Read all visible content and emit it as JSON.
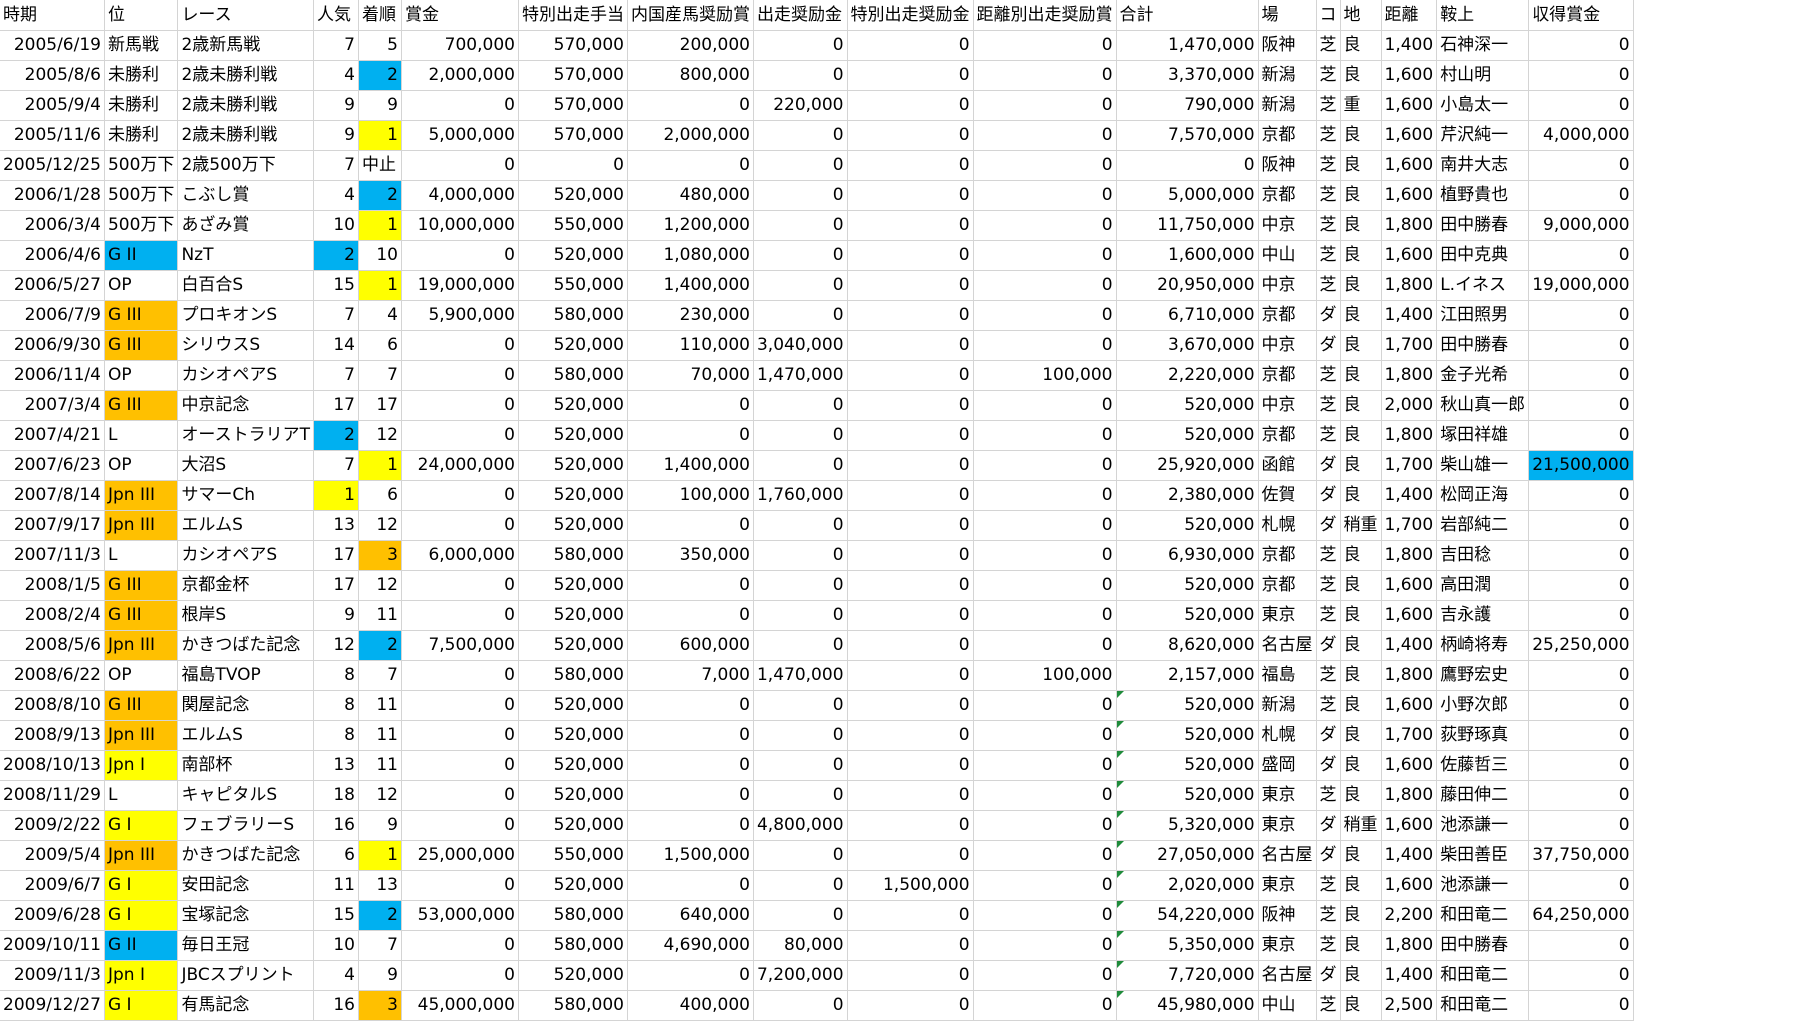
{
  "colors": {
    "yellow": "#ffff00",
    "orange": "#ffc000",
    "blue": "#00b0f0",
    "gridline": "#d4d4d4",
    "error_flag": "#1e8b3a"
  },
  "headers": [
    "時期",
    "位",
    "レース",
    "人気",
    "着順",
    "賞金",
    "特別出走手当",
    "内国産馬奨励賞",
    "出走奨励金",
    "特別出走奨励金",
    "距離別出走奨励賞",
    "合計",
    "場",
    "コ",
    "地",
    "距離",
    "鞍上",
    "収得賞金"
  ],
  "rows": [
    {
      "cells": [
        "2005/6/19",
        "新馬戦",
        "2歳新馬戦",
        "7",
        "5",
        "700,000",
        "570,000",
        "200,000",
        "0",
        "0",
        "0",
        "1,470,000",
        "阪神",
        "芝",
        "良",
        "1,400",
        "石神深一",
        "0"
      ],
      "hl": {}
    },
    {
      "cells": [
        "2005/8/6",
        "未勝利",
        "2歳未勝利戦",
        "4",
        "2",
        "2,000,000",
        "570,000",
        "800,000",
        "0",
        "0",
        "0",
        "3,370,000",
        "新潟",
        "芝",
        "良",
        "1,600",
        "村山明",
        "0"
      ],
      "hl": {
        "4": "blue"
      }
    },
    {
      "cells": [
        "2005/9/4",
        "未勝利",
        "2歳未勝利戦",
        "9",
        "9",
        "0",
        "570,000",
        "0",
        "220,000",
        "0",
        "0",
        "790,000",
        "新潟",
        "芝",
        "重",
        "1,600",
        "小島太一",
        "0"
      ],
      "hl": {}
    },
    {
      "cells": [
        "2005/11/6",
        "未勝利",
        "2歳未勝利戦",
        "9",
        "1",
        "5,000,000",
        "570,000",
        "2,000,000",
        "0",
        "0",
        "0",
        "7,570,000",
        "京都",
        "芝",
        "良",
        "1,600",
        "芹沢純一",
        "4,000,000"
      ],
      "hl": {
        "4": "yellow"
      }
    },
    {
      "cells": [
        "2005/12/25",
        "500万下",
        "2歳500万下",
        "7",
        "中止",
        "0",
        "0",
        "0",
        "0",
        "0",
        "0",
        "0",
        "阪神",
        "芝",
        "良",
        "1,600",
        "南井大志",
        "0"
      ],
      "hl": {}
    },
    {
      "cells": [
        "2006/1/28",
        "500万下",
        "こぶし賞",
        "4",
        "2",
        "4,000,000",
        "520,000",
        "480,000",
        "0",
        "0",
        "0",
        "5,000,000",
        "京都",
        "芝",
        "良",
        "1,600",
        "植野貴也",
        "0"
      ],
      "hl": {
        "4": "blue"
      }
    },
    {
      "cells": [
        "2006/3/4",
        "500万下",
        "あざみ賞",
        "10",
        "1",
        "10,000,000",
        "550,000",
        "1,200,000",
        "0",
        "0",
        "0",
        "11,750,000",
        "中京",
        "芝",
        "良",
        "1,800",
        "田中勝春",
        "9,000,000"
      ],
      "hl": {
        "4": "yellow"
      }
    },
    {
      "cells": [
        "2006/4/6",
        "G II",
        "NzT",
        "2",
        "10",
        "0",
        "520,000",
        "1,080,000",
        "0",
        "0",
        "0",
        "1,600,000",
        "中山",
        "芝",
        "良",
        "1,600",
        "田中克典",
        "0"
      ],
      "hl": {
        "1": "blue",
        "3": "blue"
      }
    },
    {
      "cells": [
        "2006/5/27",
        "OP",
        "白百合S",
        "15",
        "1",
        "19,000,000",
        "550,000",
        "1,400,000",
        "0",
        "0",
        "0",
        "20,950,000",
        "中京",
        "芝",
        "良",
        "1,800",
        "L.イネス",
        "19,000,000"
      ],
      "hl": {
        "4": "yellow"
      }
    },
    {
      "cells": [
        "2006/7/9",
        "G III",
        "プロキオンS",
        "7",
        "4",
        "5,900,000",
        "580,000",
        "230,000",
        "0",
        "0",
        "0",
        "6,710,000",
        "京都",
        "ダ",
        "良",
        "1,400",
        "江田照男",
        "0"
      ],
      "hl": {
        "1": "orange"
      }
    },
    {
      "cells": [
        "2006/9/30",
        "G III",
        "シリウスS",
        "14",
        "6",
        "0",
        "520,000",
        "110,000",
        "3,040,000",
        "0",
        "0",
        "3,670,000",
        "中京",
        "ダ",
        "良",
        "1,700",
        "田中勝春",
        "0"
      ],
      "hl": {
        "1": "orange"
      }
    },
    {
      "cells": [
        "2006/11/4",
        "OP",
        "カシオペアS",
        "7",
        "7",
        "0",
        "580,000",
        "70,000",
        "1,470,000",
        "0",
        "100,000",
        "2,220,000",
        "京都",
        "芝",
        "良",
        "1,800",
        "金子光希",
        "0"
      ],
      "hl": {}
    },
    {
      "cells": [
        "2007/3/4",
        "G III",
        "中京記念",
        "17",
        "17",
        "0",
        "520,000",
        "0",
        "0",
        "0",
        "0",
        "520,000",
        "中京",
        "芝",
        "良",
        "2,000",
        "秋山真一郎",
        "0"
      ],
      "hl": {
        "1": "orange"
      }
    },
    {
      "cells": [
        "2007/4/21",
        "L",
        "オーストラリアT",
        "2",
        "12",
        "0",
        "520,000",
        "0",
        "0",
        "0",
        "0",
        "520,000",
        "京都",
        "芝",
        "良",
        "1,800",
        "塚田祥雄",
        "0"
      ],
      "hl": {
        "3": "blue"
      }
    },
    {
      "cells": [
        "2007/6/23",
        "OP",
        "大沼S",
        "7",
        "1",
        "24,000,000",
        "520,000",
        "1,400,000",
        "0",
        "0",
        "0",
        "25,920,000",
        "函館",
        "ダ",
        "良",
        "1,700",
        "柴山雄一",
        "21,500,000"
      ],
      "hl": {
        "4": "yellow",
        "17": "blue"
      }
    },
    {
      "cells": [
        "2007/8/14",
        "Jpn III",
        "サマーCh",
        "1",
        "6",
        "0",
        "520,000",
        "100,000",
        "1,760,000",
        "0",
        "0",
        "2,380,000",
        "佐賀",
        "ダ",
        "良",
        "1,400",
        "松岡正海",
        "0"
      ],
      "hl": {
        "1": "orange",
        "3": "yellow"
      }
    },
    {
      "cells": [
        "2007/9/17",
        "Jpn III",
        "エルムS",
        "13",
        "12",
        "0",
        "520,000",
        "0",
        "0",
        "0",
        "0",
        "520,000",
        "札幌",
        "ダ",
        "稍重",
        "1,700",
        "岩部純二",
        "0"
      ],
      "hl": {
        "1": "orange"
      }
    },
    {
      "cells": [
        "2007/11/3",
        "L",
        "カシオペアS",
        "17",
        "3",
        "6,000,000",
        "580,000",
        "350,000",
        "0",
        "0",
        "0",
        "6,930,000",
        "京都",
        "芝",
        "良",
        "1,800",
        "吉田稔",
        "0"
      ],
      "hl": {
        "4": "orange"
      }
    },
    {
      "cells": [
        "2008/1/5",
        "G III",
        "京都金杯",
        "17",
        "12",
        "0",
        "520,000",
        "0",
        "0",
        "0",
        "0",
        "520,000",
        "京都",
        "芝",
        "良",
        "1,600",
        "高田潤",
        "0"
      ],
      "hl": {
        "1": "orange"
      }
    },
    {
      "cells": [
        "2008/2/4",
        "G III",
        "根岸S",
        "9",
        "11",
        "0",
        "520,000",
        "0",
        "0",
        "0",
        "0",
        "520,000",
        "東京",
        "芝",
        "良",
        "1,600",
        "吉永護",
        "0"
      ],
      "hl": {
        "1": "orange"
      }
    },
    {
      "cells": [
        "2008/5/6",
        "Jpn III",
        "かきつばた記念",
        "12",
        "2",
        "7,500,000",
        "520,000",
        "600,000",
        "0",
        "0",
        "0",
        "8,620,000",
        "名古屋",
        "ダ",
        "良",
        "1,400",
        "柄崎将寿",
        "25,250,000"
      ],
      "hl": {
        "1": "orange",
        "4": "blue"
      }
    },
    {
      "cells": [
        "2008/6/22",
        "OP",
        "福島TVOP",
        "8",
        "7",
        "0",
        "580,000",
        "7,000",
        "1,470,000",
        "0",
        "100,000",
        "2,157,000",
        "福島",
        "芝",
        "良",
        "1,800",
        "鷹野宏史",
        "0"
      ],
      "hl": {}
    },
    {
      "cells": [
        "2008/8/10",
        "G III",
        "関屋記念",
        "8",
        "11",
        "0",
        "520,000",
        "0",
        "0",
        "0",
        "0",
        "520,000",
        "新潟",
        "芝",
        "良",
        "1,600",
        "小野次郎",
        "0"
      ],
      "hl": {
        "1": "orange"
      },
      "tri": true
    },
    {
      "cells": [
        "2008/9/13",
        "Jpn III",
        "エルムS",
        "8",
        "11",
        "0",
        "520,000",
        "0",
        "0",
        "0",
        "0",
        "520,000",
        "札幌",
        "ダ",
        "良",
        "1,700",
        "荻野琢真",
        "0"
      ],
      "hl": {
        "1": "orange"
      },
      "tri": true
    },
    {
      "cells": [
        "2008/10/13",
        "Jpn I",
        "南部杯",
        "13",
        "11",
        "0",
        "520,000",
        "0",
        "0",
        "0",
        "0",
        "520,000",
        "盛岡",
        "ダ",
        "良",
        "1,600",
        "佐藤哲三",
        "0"
      ],
      "hl": {
        "1": "yellow"
      },
      "tri": true
    },
    {
      "cells": [
        "2008/11/29",
        "L",
        "キャピタルS",
        "18",
        "12",
        "0",
        "520,000",
        "0",
        "0",
        "0",
        "0",
        "520,000",
        "東京",
        "芝",
        "良",
        "1,800",
        "藤田伸二",
        "0"
      ],
      "hl": {},
      "tri": true
    },
    {
      "cells": [
        "2009/2/22",
        "G I",
        "フェブラリーS",
        "16",
        "9",
        "0",
        "520,000",
        "0",
        "4,800,000",
        "0",
        "0",
        "5,320,000",
        "東京",
        "ダ",
        "稍重",
        "1,600",
        "池添謙一",
        "0"
      ],
      "hl": {
        "1": "yellow"
      },
      "tri": true
    },
    {
      "cells": [
        "2009/5/4",
        "Jpn III",
        "かきつばた記念",
        "6",
        "1",
        "25,000,000",
        "550,000",
        "1,500,000",
        "0",
        "0",
        "0",
        "27,050,000",
        "名古屋",
        "ダ",
        "良",
        "1,400",
        "柴田善臣",
        "37,750,000"
      ],
      "hl": {
        "1": "orange",
        "4": "yellow"
      },
      "tri": true
    },
    {
      "cells": [
        "2009/6/7",
        "G I",
        "安田記念",
        "11",
        "13",
        "0",
        "520,000",
        "0",
        "0",
        "1,500,000",
        "0",
        "2,020,000",
        "東京",
        "芝",
        "良",
        "1,600",
        "池添謙一",
        "0"
      ],
      "hl": {
        "1": "yellow"
      },
      "tri": true
    },
    {
      "cells": [
        "2009/6/28",
        "G I",
        "宝塚記念",
        "15",
        "2",
        "53,000,000",
        "580,000",
        "640,000",
        "0",
        "0",
        "0",
        "54,220,000",
        "阪神",
        "芝",
        "良",
        "2,200",
        "和田竜二",
        "64,250,000"
      ],
      "hl": {
        "1": "yellow",
        "4": "blue"
      },
      "tri": true
    },
    {
      "cells": [
        "2009/10/11",
        "G II",
        "毎日王冠",
        "10",
        "7",
        "0",
        "580,000",
        "4,690,000",
        "80,000",
        "0",
        "0",
        "5,350,000",
        "東京",
        "芝",
        "良",
        "1,800",
        "田中勝春",
        "0"
      ],
      "hl": {
        "1": "blue"
      },
      "tri": true
    },
    {
      "cells": [
        "2009/11/3",
        "Jpn I",
        "JBCスプリント",
        "4",
        "9",
        "0",
        "520,000",
        "0",
        "7,200,000",
        "0",
        "0",
        "7,720,000",
        "名古屋",
        "ダ",
        "良",
        "1,400",
        "和田竜二",
        "0"
      ],
      "hl": {
        "1": "yellow"
      },
      "tri": true
    },
    {
      "cells": [
        "2009/12/27",
        "G I",
        "有馬記念",
        "16",
        "3",
        "45,000,000",
        "580,000",
        "400,000",
        "0",
        "0",
        "0",
        "45,980,000",
        "中山",
        "芝",
        "良",
        "2,500",
        "和田竜二",
        "0"
      ],
      "hl": {
        "1": "yellow",
        "4": "orange"
      },
      "tri": true
    }
  ]
}
